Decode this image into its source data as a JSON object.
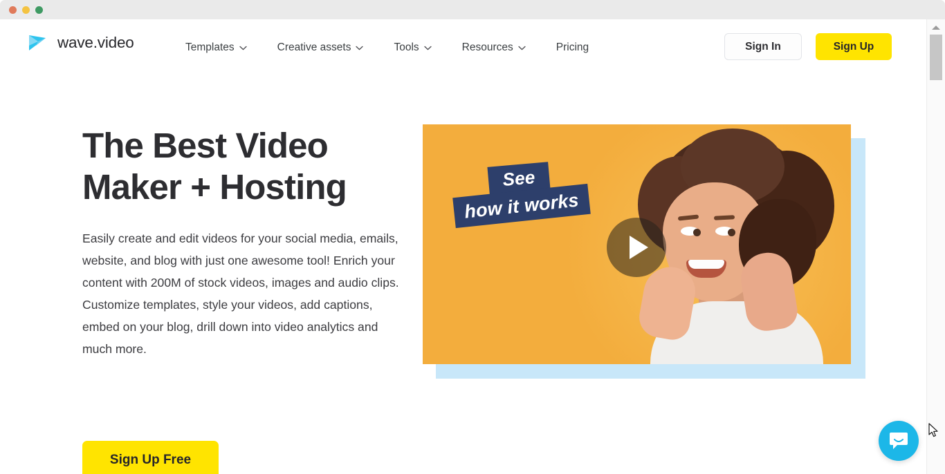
{
  "window": {
    "traffic_lights": [
      {
        "name": "close",
        "color": "#e07a5a"
      },
      {
        "name": "minimize",
        "color": "#f4c341"
      },
      {
        "name": "zoom",
        "color": "#3f9a63"
      }
    ]
  },
  "header": {
    "logo": {
      "text": "wave.video",
      "icon": "play-triangle-logo-icon",
      "color": "#1cb7e8"
    },
    "nav": [
      {
        "label": "Templates",
        "has_dropdown": true
      },
      {
        "label": "Creative assets",
        "has_dropdown": true
      },
      {
        "label": "Tools",
        "has_dropdown": true
      },
      {
        "label": "Resources",
        "has_dropdown": true
      },
      {
        "label": "Pricing",
        "has_dropdown": false
      }
    ],
    "sign_in_label": "Sign In",
    "sign_up_label": "Sign Up"
  },
  "hero": {
    "title": "The Best Video Maker + Hosting",
    "paragraph": "Easily create and edit videos for your social media, emails, website, and blog with just one awesome tool!\nEnrich your content with 200M of stock videos, images and audio clips. Customize templates, style your videos, add captions, embed on your blog, drill down into video analytics and much more.",
    "cta_label": "Sign Up Free",
    "video": {
      "overlay_line_1": "See",
      "overlay_line_2": "how it works",
      "play_icon": "play-icon",
      "background_color": "#f3ad3d",
      "overlay_tag_color": "#2d3f6b",
      "offset_shade_color": "#c8e7f9"
    }
  },
  "chat": {
    "icon": "chat-bubble-icon",
    "color": "#1cb7e8"
  },
  "colors": {
    "accent_yellow": "#ffe400",
    "brand_blue": "#1cb7e8",
    "text_dark": "#2d2d31"
  }
}
